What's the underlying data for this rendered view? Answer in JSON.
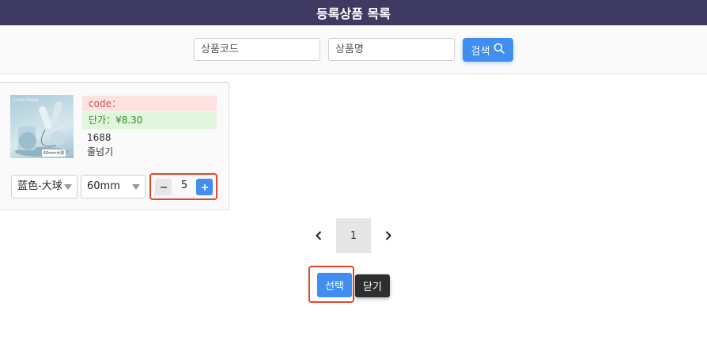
{
  "header": {
    "title": "등록상품 목록"
  },
  "search": {
    "code_placeholder": "상품코드",
    "name_placeholder": "상품명",
    "button_label": "검색"
  },
  "product": {
    "code_label": "code：",
    "price_label": "단가：¥8.30",
    "source": "1688",
    "name": "줄넘기",
    "image_text": "Jump Rope",
    "image_tag": "60mm大球",
    "option_color": "蓝色-大球",
    "option_size": "60mm",
    "quantity": "5"
  },
  "pagination": {
    "current_page": "1"
  },
  "actions": {
    "select_label": "선택",
    "close_label": "닫기"
  },
  "colors": {
    "header_bg": "#3e3a62",
    "accent": "#3f8ef0",
    "highlight": "#e5462a"
  }
}
